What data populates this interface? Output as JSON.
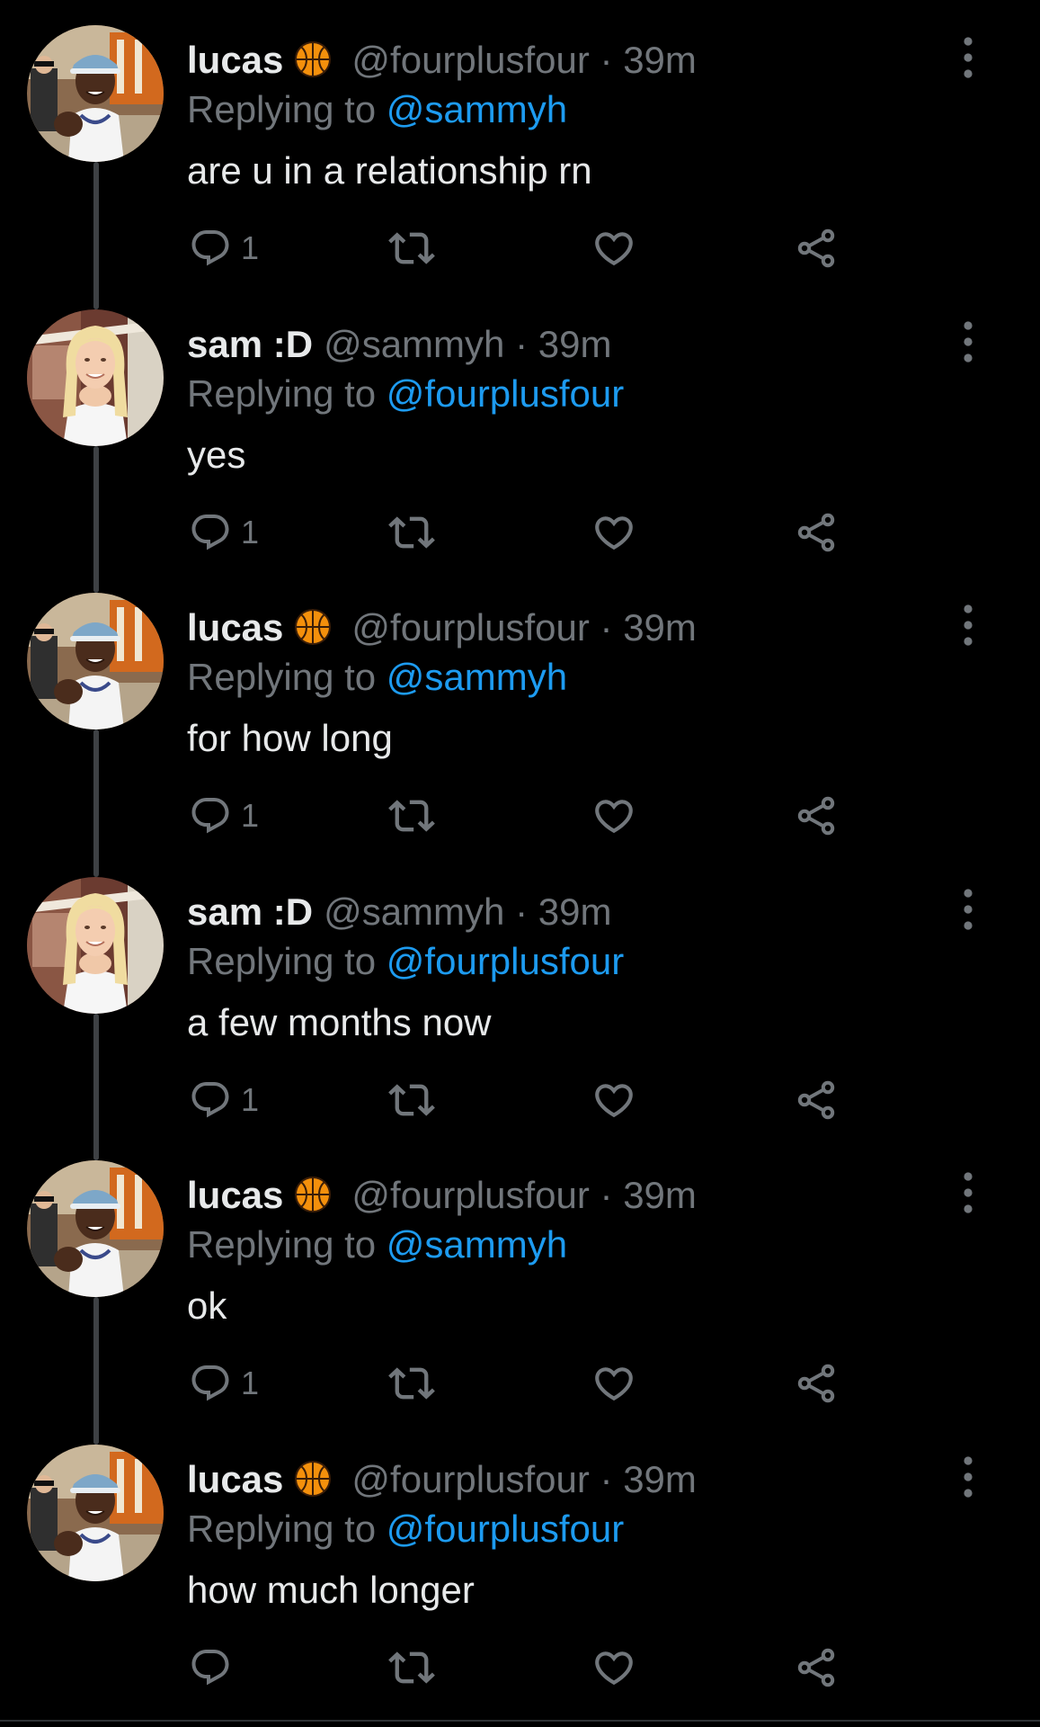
{
  "colors": {
    "background": "#000000",
    "text_primary": "#e7e9ea",
    "text_secondary": "#71767b",
    "link": "#1d9bf0",
    "thread_line": "#3e4144"
  },
  "reply_prefix": "Replying to",
  "tweets": [
    {
      "display_name": "lucas",
      "has_emoji": true,
      "emoji_icon": "basketball-emoji",
      "handle": "@fourplusfour",
      "separator": "·",
      "time": "39m",
      "reply_to": "@sammyh",
      "text": "are u in a relationship rn",
      "reply_count": "1",
      "avatar": "lucas"
    },
    {
      "display_name": "sam :D",
      "has_emoji": false,
      "handle": "@sammyh",
      "separator": "·",
      "time": "39m",
      "reply_to": "@fourplusfour",
      "text": "yes",
      "reply_count": "1",
      "avatar": "sam"
    },
    {
      "display_name": "lucas",
      "has_emoji": true,
      "emoji_icon": "basketball-emoji",
      "handle": "@fourplusfour",
      "separator": "·",
      "time": "39m",
      "reply_to": "@sammyh",
      "text": "for how long",
      "reply_count": "1",
      "avatar": "lucas"
    },
    {
      "display_name": "sam :D",
      "has_emoji": false,
      "handle": "@sammyh",
      "separator": "·",
      "time": "39m",
      "reply_to": "@fourplusfour",
      "text": "a few months now",
      "reply_count": "1",
      "avatar": "sam"
    },
    {
      "display_name": "lucas",
      "has_emoji": true,
      "emoji_icon": "basketball-emoji",
      "handle": "@fourplusfour",
      "separator": "·",
      "time": "39m",
      "reply_to": "@sammyh",
      "text": "ok",
      "reply_count": "1",
      "avatar": "lucas"
    },
    {
      "display_name": "lucas",
      "has_emoji": true,
      "emoji_icon": "basketball-emoji",
      "handle": "@fourplusfour",
      "separator": "·",
      "time": "39m",
      "reply_to": "@fourplusfour",
      "text": "how much longer",
      "reply_count": "",
      "avatar": "lucas"
    }
  ],
  "icons": {
    "more": "more-vertical-icon",
    "reply": "reply-icon",
    "retweet": "retweet-icon",
    "like": "heart-icon",
    "share": "share-icon"
  }
}
